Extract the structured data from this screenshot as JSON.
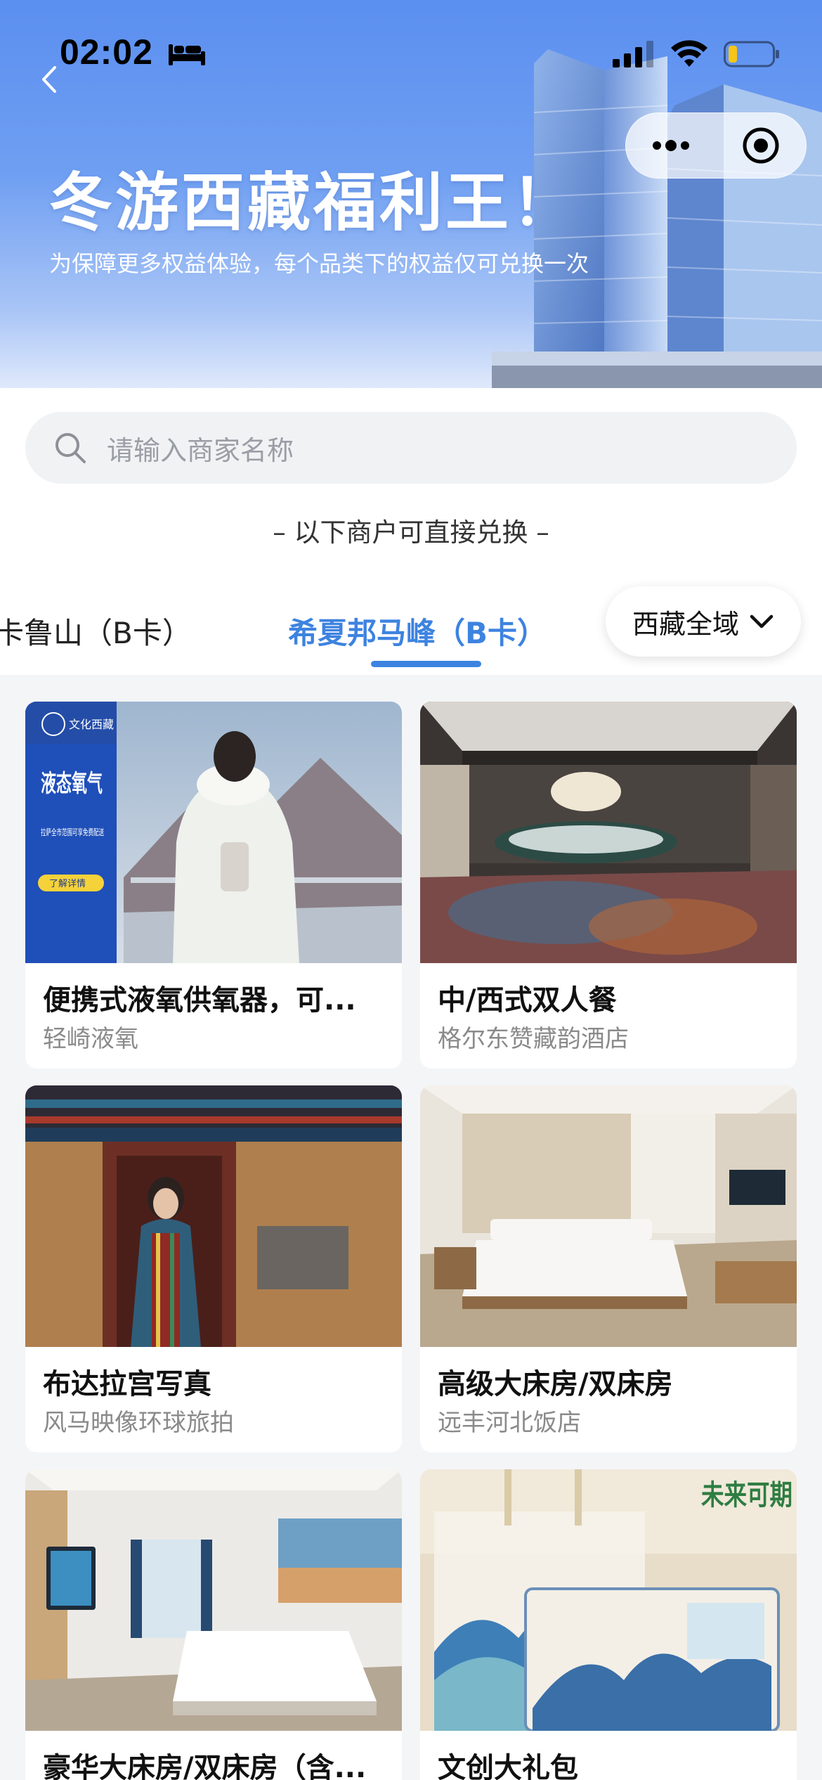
{
  "status_bar": {
    "time": "02:02"
  },
  "hero": {
    "title": "冬游西藏福利王！",
    "subtitle": "为保障更多权益体验，每个品类下的权益仅可兑换一次"
  },
  "search": {
    "placeholder": "请输入商家名称"
  },
  "section_note": "– 以下商户可直接兑换 –",
  "tabs": [
    {
      "label": "卡鲁山（B卡）",
      "active": false
    },
    {
      "label": "希夏邦马峰（B卡）",
      "active": true
    }
  ],
  "region_filter": {
    "label": "西藏全域"
  },
  "image_text": {
    "oxygen_brand": "文化西藏",
    "oxygen_headline": "液态氧气",
    "oxygen_desc": "拉萨全市范围可享免费配送",
    "oxygen_btn": "了解详情",
    "gift_text": "未来可期"
  },
  "products": [
    {
      "name": "便携式液氧供氧器，可...",
      "shop": "轻崎液氧"
    },
    {
      "name": "中/西式双人餐",
      "shop": "格尔东赞藏韵酒店"
    },
    {
      "name": "布达拉宫写真",
      "shop": "风马映像环球旅拍"
    },
    {
      "name": "高级大床房/双床房",
      "shop": "远丰河北饭店"
    },
    {
      "name": "豪华大床房/双床房（含...",
      "shop": ""
    },
    {
      "name": "文创大礼包",
      "shop": ""
    }
  ]
}
